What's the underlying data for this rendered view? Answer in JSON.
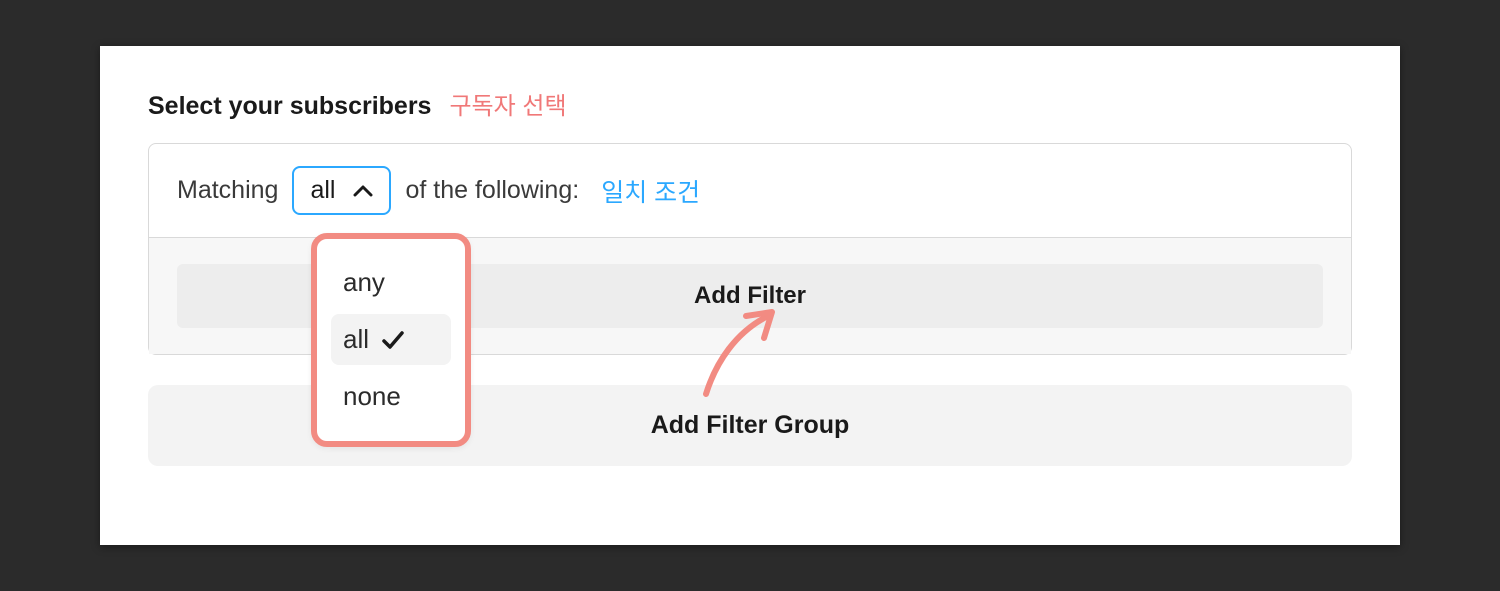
{
  "title": "Select your subscribers",
  "title_annotation": "구독자 선택",
  "matching": {
    "prefix": "Matching",
    "selected": "all",
    "suffix": "of the following:",
    "annotation": "일치 조건",
    "options": [
      "any",
      "all",
      "none"
    ]
  },
  "add_filter_label": "Add Filter",
  "add_filter_group_label": "Add Filter Group",
  "colors": {
    "annotation_red": "#f28b82",
    "annotation_blue": "#2ba8ff"
  }
}
